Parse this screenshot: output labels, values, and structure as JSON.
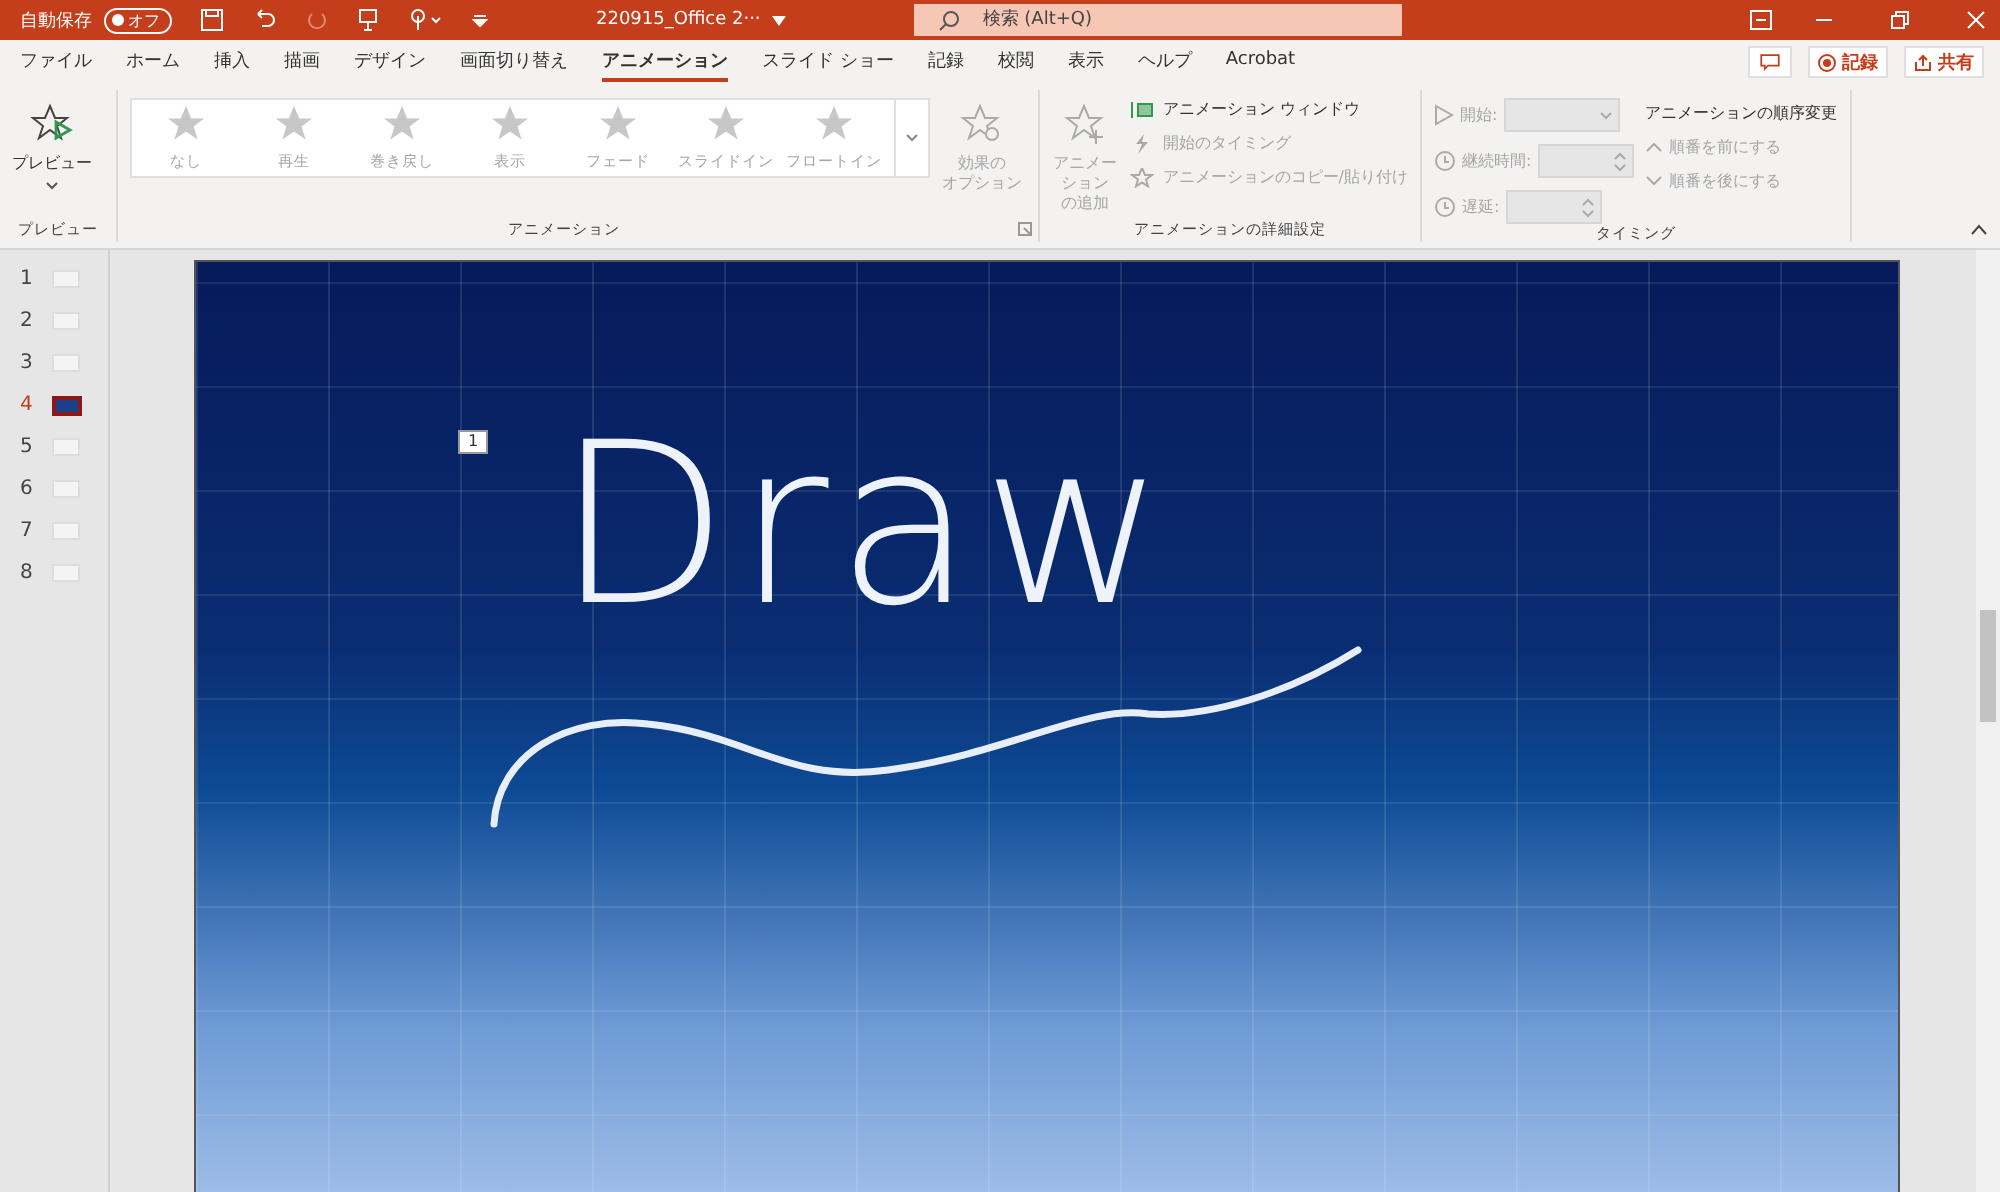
{
  "title_bar": {
    "autosave_label": "自動保存",
    "autosave_toggle": {
      "label": "オフ",
      "on": false
    },
    "filename": "220915_Office 2···",
    "search": {
      "placeholder": "検索 (Alt+Q)"
    }
  },
  "menu_tabs": [
    {
      "label": "ファイル",
      "selected": false
    },
    {
      "label": "ホーム",
      "selected": false
    },
    {
      "label": "挿入",
      "selected": false
    },
    {
      "label": "描画",
      "selected": false
    },
    {
      "label": "デザイン",
      "selected": false
    },
    {
      "label": "画面切り替え",
      "selected": false
    },
    {
      "label": "アニメーション",
      "selected": true
    },
    {
      "label": "スライド ショー",
      "selected": false
    },
    {
      "label": "記録",
      "selected": false
    },
    {
      "label": "校閲",
      "selected": false
    },
    {
      "label": "表示",
      "selected": false
    },
    {
      "label": "ヘルプ",
      "selected": false
    },
    {
      "label": "Acrobat",
      "selected": false
    }
  ],
  "header_buttons": {
    "record": "記録",
    "share": "共有"
  },
  "ribbon": {
    "preview": {
      "button": "プレビュー",
      "group_label": "プレビュー"
    },
    "animation": {
      "gallery": [
        {
          "label": "なし",
          "disabled": true
        },
        {
          "label": "再生",
          "disabled": true
        },
        {
          "label": "巻き戻し",
          "disabled": true
        },
        {
          "label": "表示",
          "disabled": true
        },
        {
          "label": "フェード",
          "disabled": true
        },
        {
          "label": "スライドイン",
          "disabled": true
        },
        {
          "label": "フロートイン",
          "disabled": true
        }
      ],
      "effect_options": [
        "効果の",
        "オプション"
      ],
      "group_label": "アニメーション"
    },
    "advanced": {
      "add_animation": [
        "アニメーション",
        "の追加"
      ],
      "items": [
        {
          "label": "アニメーション ウィンドウ",
          "disabled": false
        },
        {
          "label": "開始のタイミング",
          "disabled": true
        },
        {
          "label": "アニメーションのコピー/貼り付け",
          "disabled": true
        }
      ],
      "group_label": "アニメーションの詳細設定"
    },
    "timing": {
      "fields": [
        {
          "label": "開始:",
          "kind": "dropdown"
        },
        {
          "label": "継続時間:",
          "kind": "spinner"
        },
        {
          "label": "遅延:",
          "kind": "spinner"
        }
      ],
      "reorder_title": "アニメーションの順序変更",
      "reorder": [
        {
          "label": "順番を前にする",
          "disabled": true
        },
        {
          "label": "順番を後にする",
          "disabled": true
        }
      ],
      "group_label": "タイミング"
    }
  },
  "slides": [
    {
      "number": "1",
      "selected": false
    },
    {
      "number": "2",
      "selected": false
    },
    {
      "number": "3",
      "selected": false
    },
    {
      "number": "4",
      "selected": true
    },
    {
      "number": "5",
      "selected": false
    },
    {
      "number": "6",
      "selected": false
    },
    {
      "number": "7",
      "selected": false
    },
    {
      "number": "8",
      "selected": false
    }
  ],
  "slide": {
    "order_tag": "1",
    "ink_text": "Draw"
  }
}
